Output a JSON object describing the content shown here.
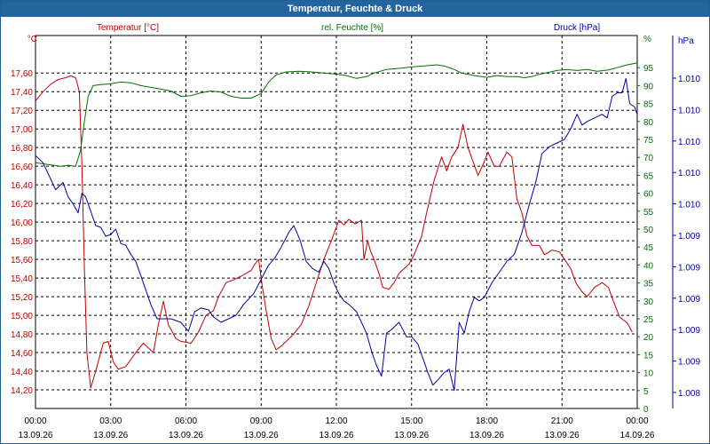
{
  "window": {
    "title": "Temperatur, Feuchte & Druck"
  },
  "colors": {
    "temperature": "#c00000",
    "humidity": "#007000",
    "pressure": "#0000a0",
    "grid": "#000000",
    "titlebar": "#24649f"
  },
  "chart_data": {
    "type": "line",
    "title": "Temperatur, Feuchte & Druck",
    "grid": true,
    "x_ticks": [
      {
        "time": "00:00",
        "date": "13.09.26"
      },
      {
        "time": "03:00",
        "date": "13.09.26"
      },
      {
        "time": "06:00",
        "date": "13.09.26"
      },
      {
        "time": "09:00",
        "date": "13.09.26"
      },
      {
        "time": "12:00",
        "date": "13.09.26"
      },
      {
        "time": "15:00",
        "date": "13.09.26"
      },
      {
        "time": "18:00",
        "date": "13.09.26"
      },
      {
        "time": "21:00",
        "date": "13.09.26"
      },
      {
        "time": "00:00",
        "date": "14.09.26"
      }
    ],
    "xlim": [
      0,
      24
    ],
    "x_unit": "hours since 13.09.26 00:00",
    "axes": {
      "temperature": {
        "label": "Temperatur [°C]",
        "unit": "°C",
        "side": "left",
        "ylim": [
          14.0,
          17.85
        ],
        "ticks": [
          "17,60",
          "17,40",
          "17,20",
          "17,00",
          "16,80",
          "16,60",
          "16,40",
          "16,20",
          "16,00",
          "15,80",
          "15,60",
          "15,40",
          "15,20",
          "15,00",
          "14,80",
          "14,60",
          "14,40",
          "14,20"
        ]
      },
      "humidity": {
        "label": "rel. Feuchte [%]",
        "unit": "%",
        "side": "right",
        "ylim": [
          0,
          100
        ],
        "ticks": [
          "95",
          "90",
          "85",
          "80",
          "75",
          "70",
          "65",
          "60",
          "55",
          "50",
          "45",
          "40",
          "35",
          "30",
          "25",
          "20",
          "15",
          "10",
          "5",
          "0"
        ]
      },
      "pressure": {
        "label": "Druck [hPa]",
        "unit": "hPa",
        "side": "right-outer",
        "ticks": [
          "1.010",
          "1.010",
          "1.010",
          "1.010",
          "1.010",
          "1.009",
          "1.009",
          "1.009",
          "1.009",
          "1.009",
          "1.008"
        ]
      }
    },
    "series": [
      {
        "name": "Temperatur [°C]",
        "axis": "temperature",
        "points": [
          [
            0,
            17.3
          ],
          [
            0.3,
            17.4
          ],
          [
            0.6,
            17.48
          ],
          [
            0.9,
            17.53
          ],
          [
            1.2,
            17.55
          ],
          [
            1.4,
            17.57
          ],
          [
            1.6,
            17.55
          ],
          [
            1.75,
            17.4
          ],
          [
            1.85,
            16.6
          ],
          [
            1.95,
            15.5
          ],
          [
            2.05,
            14.6
          ],
          [
            2.2,
            14.22
          ],
          [
            2.4,
            14.4
          ],
          [
            2.7,
            14.7
          ],
          [
            2.9,
            14.72
          ],
          [
            3.1,
            14.5
          ],
          [
            3.3,
            14.42
          ],
          [
            3.6,
            14.45
          ],
          [
            4.0,
            14.6
          ],
          [
            4.3,
            14.7
          ],
          [
            4.7,
            14.6
          ],
          [
            4.9,
            14.9
          ],
          [
            5.1,
            15.15
          ],
          [
            5.3,
            14.9
          ],
          [
            5.6,
            14.75
          ],
          [
            5.8,
            14.72
          ],
          [
            6.2,
            14.7
          ],
          [
            6.5,
            14.82
          ],
          [
            6.8,
            15.0
          ],
          [
            7.1,
            15.05
          ],
          [
            7.3,
            15.2
          ],
          [
            7.6,
            15.35
          ],
          [
            7.9,
            15.38
          ],
          [
            8.2,
            15.42
          ],
          [
            8.4,
            15.45
          ],
          [
            8.6,
            15.48
          ],
          [
            8.75,
            15.55
          ],
          [
            8.9,
            15.6
          ],
          [
            9.05,
            15.3
          ],
          [
            9.2,
            15.05
          ],
          [
            9.4,
            14.75
          ],
          [
            9.6,
            14.63
          ],
          [
            9.8,
            14.67
          ],
          [
            10.0,
            14.72
          ],
          [
            10.3,
            14.8
          ],
          [
            10.6,
            14.9
          ],
          [
            10.9,
            15.1
          ],
          [
            11.2,
            15.35
          ],
          [
            11.5,
            15.6
          ],
          [
            11.8,
            15.8
          ],
          [
            12.1,
            16.02
          ],
          [
            12.3,
            15.97
          ],
          [
            12.5,
            16.03
          ],
          [
            12.75,
            15.98
          ],
          [
            13.0,
            16.02
          ],
          [
            13.1,
            15.6
          ],
          [
            13.25,
            15.8
          ],
          [
            13.35,
            15.7
          ],
          [
            13.5,
            15.6
          ],
          [
            13.7,
            15.45
          ],
          [
            13.85,
            15.3
          ],
          [
            14.1,
            15.28
          ],
          [
            14.3,
            15.35
          ],
          [
            14.5,
            15.45
          ],
          [
            14.7,
            15.5
          ],
          [
            14.9,
            15.55
          ],
          [
            15.1,
            15.65
          ],
          [
            15.4,
            15.85
          ],
          [
            15.6,
            16.1
          ],
          [
            15.9,
            16.45
          ],
          [
            16.2,
            16.7
          ],
          [
            16.4,
            16.55
          ],
          [
            16.6,
            16.7
          ],
          [
            16.85,
            16.8
          ],
          [
            17.05,
            17.05
          ],
          [
            17.25,
            16.8
          ],
          [
            17.45,
            16.65
          ],
          [
            17.65,
            16.5
          ],
          [
            17.85,
            16.62
          ],
          [
            18.05,
            16.75
          ],
          [
            18.3,
            16.6
          ],
          [
            18.5,
            16.6
          ],
          [
            18.8,
            16.75
          ],
          [
            19.0,
            16.7
          ],
          [
            19.2,
            16.25
          ],
          [
            19.4,
            16.1
          ],
          [
            19.6,
            15.85
          ],
          [
            19.8,
            15.75
          ],
          [
            20.1,
            15.75
          ],
          [
            20.3,
            15.65
          ],
          [
            20.6,
            15.7
          ],
          [
            20.9,
            15.68
          ],
          [
            21.1,
            15.6
          ],
          [
            21.35,
            15.5
          ],
          [
            21.55,
            15.35
          ],
          [
            21.8,
            15.25
          ],
          [
            22.0,
            15.2
          ],
          [
            22.3,
            15.3
          ],
          [
            22.6,
            15.35
          ],
          [
            22.85,
            15.3
          ],
          [
            23.05,
            15.15
          ],
          [
            23.3,
            14.98
          ],
          [
            23.6,
            14.92
          ],
          [
            23.8,
            14.82
          ]
        ]
      },
      {
        "name": "rel. Feuchte [%]",
        "axis": "humidity",
        "points": [
          [
            0,
            68.5
          ],
          [
            0.5,
            68
          ],
          [
            1.0,
            67.5
          ],
          [
            1.3,
            67.8
          ],
          [
            1.6,
            67.5
          ],
          [
            1.8,
            72
          ],
          [
            1.95,
            80
          ],
          [
            2.1,
            87
          ],
          [
            2.3,
            90
          ],
          [
            2.6,
            90.3
          ],
          [
            3.0,
            90.5
          ],
          [
            3.4,
            91
          ],
          [
            3.8,
            90.8
          ],
          [
            4.2,
            90
          ],
          [
            4.6,
            89.5
          ],
          [
            5.0,
            89
          ],
          [
            5.4,
            88.5
          ],
          [
            5.8,
            87
          ],
          [
            6.2,
            87.2
          ],
          [
            6.6,
            88
          ],
          [
            7.0,
            88.5
          ],
          [
            7.4,
            88.2
          ],
          [
            7.8,
            87
          ],
          [
            8.2,
            86.5
          ],
          [
            8.6,
            86.5
          ],
          [
            9.0,
            87.8
          ],
          [
            9.3,
            91
          ],
          [
            9.6,
            93
          ],
          [
            10.0,
            93.8
          ],
          [
            10.5,
            94
          ],
          [
            11.0,
            93.8
          ],
          [
            11.5,
            93.5
          ],
          [
            12.0,
            93.2
          ],
          [
            12.4,
            92.8
          ],
          [
            12.8,
            92
          ],
          [
            13.2,
            92.5
          ],
          [
            13.5,
            93.5
          ],
          [
            14.0,
            94.5
          ],
          [
            14.5,
            94.8
          ],
          [
            15.0,
            95.2
          ],
          [
            15.5,
            95.5
          ],
          [
            16.0,
            95.8
          ],
          [
            16.3,
            95.5
          ],
          [
            16.7,
            94.5
          ],
          [
            17.0,
            93.5
          ],
          [
            17.5,
            92.8
          ],
          [
            18.0,
            92.3
          ],
          [
            18.4,
            92.8
          ],
          [
            18.8,
            92.5
          ],
          [
            19.2,
            92.5
          ],
          [
            19.5,
            92.2
          ],
          [
            19.8,
            92.5
          ],
          [
            20.0,
            93
          ],
          [
            20.4,
            93.6
          ],
          [
            20.8,
            94.2
          ],
          [
            21.2,
            94.5
          ],
          [
            21.6,
            94.2
          ],
          [
            22.0,
            94.5
          ],
          [
            22.4,
            94
          ],
          [
            22.8,
            94.3
          ],
          [
            23.2,
            95
          ],
          [
            23.6,
            95.8
          ],
          [
            24,
            96.3
          ]
        ]
      },
      {
        "name": "Druck [hPa]",
        "axis": "pressure",
        "points": [
          [
            0,
            70.5
          ],
          [
            0.3,
            68.5
          ],
          [
            0.6,
            64
          ],
          [
            0.8,
            61
          ],
          [
            1.1,
            63
          ],
          [
            1.3,
            59
          ],
          [
            1.5,
            57
          ],
          [
            1.7,
            54.5
          ],
          [
            1.85,
            60
          ],
          [
            2.0,
            59
          ],
          [
            2.2,
            55
          ],
          [
            2.4,
            51
          ],
          [
            2.6,
            50.5
          ],
          [
            2.8,
            48
          ],
          [
            3.0,
            48.5
          ],
          [
            3.2,
            50
          ],
          [
            3.4,
            46
          ],
          [
            3.6,
            45.5
          ],
          [
            3.8,
            43
          ],
          [
            4.0,
            41
          ],
          [
            4.3,
            35
          ],
          [
            4.6,
            29
          ],
          [
            4.85,
            25
          ],
          [
            5.1,
            25
          ],
          [
            5.4,
            25
          ],
          [
            5.8,
            24
          ],
          [
            6.1,
            21.5
          ],
          [
            6.35,
            27
          ],
          [
            6.6,
            28
          ],
          [
            6.9,
            27.5
          ],
          [
            7.1,
            25.5
          ],
          [
            7.4,
            24
          ],
          [
            7.7,
            25
          ],
          [
            8.0,
            26
          ],
          [
            8.3,
            29
          ],
          [
            8.7,
            32
          ],
          [
            9.0,
            36
          ],
          [
            9.3,
            40
          ],
          [
            9.55,
            42
          ],
          [
            9.8,
            45
          ],
          [
            10.1,
            49
          ],
          [
            10.3,
            51
          ],
          [
            10.55,
            47
          ],
          [
            10.8,
            41
          ],
          [
            11.05,
            39
          ],
          [
            11.3,
            38
          ],
          [
            11.5,
            41
          ],
          [
            11.7,
            39
          ],
          [
            11.9,
            35
          ],
          [
            12.1,
            32
          ],
          [
            12.3,
            30
          ],
          [
            12.5,
            29
          ],
          [
            12.8,
            27
          ],
          [
            13.0,
            24
          ],
          [
            13.2,
            21
          ],
          [
            13.4,
            16
          ],
          [
            13.6,
            12
          ],
          [
            13.8,
            9
          ],
          [
            14.0,
            21
          ],
          [
            14.2,
            22
          ],
          [
            14.5,
            24
          ],
          [
            14.8,
            20
          ],
          [
            15.0,
            20
          ],
          [
            15.25,
            18
          ],
          [
            15.45,
            14
          ],
          [
            15.65,
            10
          ],
          [
            15.85,
            6.5
          ],
          [
            16.05,
            8
          ],
          [
            16.3,
            10
          ],
          [
            16.5,
            11
          ],
          [
            16.7,
            5
          ],
          [
            16.9,
            24
          ],
          [
            17.1,
            21
          ],
          [
            17.3,
            27
          ],
          [
            17.5,
            31
          ],
          [
            17.7,
            30
          ],
          [
            17.9,
            31
          ],
          [
            18.2,
            35
          ],
          [
            18.5,
            38
          ],
          [
            18.8,
            41
          ],
          [
            19.1,
            43
          ],
          [
            19.4,
            49
          ],
          [
            19.7,
            57
          ],
          [
            19.95,
            63
          ],
          [
            20.2,
            71
          ],
          [
            20.5,
            73
          ],
          [
            20.8,
            74
          ],
          [
            21.1,
            75
          ],
          [
            21.35,
            78
          ],
          [
            21.6,
            82
          ],
          [
            21.8,
            79
          ],
          [
            22.0,
            80
          ],
          [
            22.3,
            81
          ],
          [
            22.6,
            82
          ],
          [
            22.8,
            81
          ],
          [
            23.0,
            87
          ],
          [
            23.2,
            88
          ],
          [
            23.4,
            88
          ],
          [
            23.55,
            92
          ],
          [
            23.7,
            85
          ],
          [
            23.9,
            84
          ],
          [
            24,
            82
          ]
        ]
      }
    ]
  }
}
